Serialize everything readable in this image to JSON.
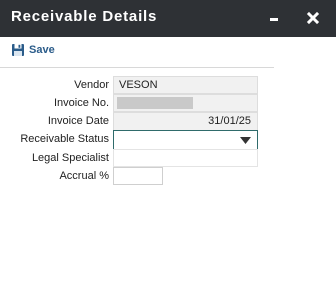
{
  "window": {
    "title": "Receivable Details",
    "minimize_icon": "minimize-icon",
    "close_icon": "close-icon"
  },
  "toolbar": {
    "save_label": "Save",
    "save_icon": "floppy-disk-icon"
  },
  "form": {
    "vendor": {
      "label": "Vendor",
      "value": "VESON"
    },
    "invoice_no": {
      "label": "Invoice No.",
      "value": ""
    },
    "invoice_date": {
      "label": "Invoice Date",
      "value": "31/01/25"
    },
    "receivable_status": {
      "label": "Receivable Status",
      "value": ""
    },
    "legal_specialist": {
      "label": "Legal Specialist",
      "value": ""
    },
    "accrual_pct": {
      "label": "Accrual %",
      "value": ""
    }
  },
  "colors": {
    "titlebar_bg": "#2e3135",
    "save_text": "#2b5c8a",
    "select_border": "#2f6b6b"
  }
}
